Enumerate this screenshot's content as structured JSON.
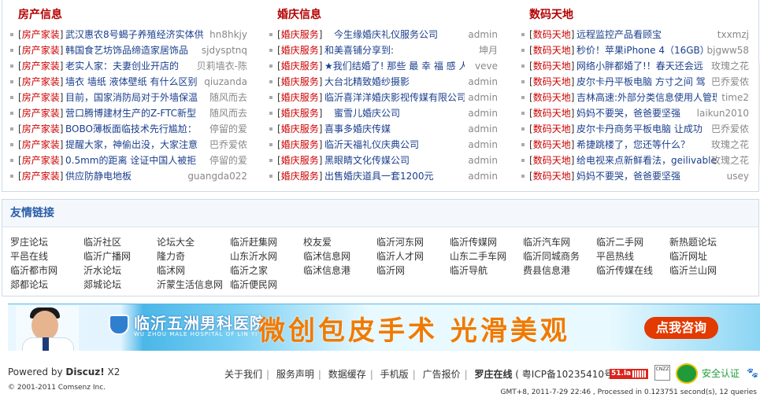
{
  "columns": [
    {
      "title": "房产信息",
      "rows": [
        {
          "cat": "房产家装",
          "title": "武汉惠农8号蝎子养殖经济实体供",
          "author": "hn8hkjy"
        },
        {
          "cat": "房产家装",
          "title": "韩国食艺坊饰品缔造家居饰品",
          "author": "sjdysptnq"
        },
        {
          "cat": "房产家装",
          "title": "老实人家：夫妻创业开店的",
          "author": "贝莉墙衣-陈"
        },
        {
          "cat": "房产家装",
          "title": "墙衣 墙纸 液体壁纸 有什么区别",
          "author": "qiuzanda"
        },
        {
          "cat": "房产家装",
          "title": "目前，国家消防局对于外墙保温",
          "author": "随风而去"
        },
        {
          "cat": "房产家装",
          "title": "营口腾博建材生产的Z-FTC新型",
          "author": "随风而去"
        },
        {
          "cat": "房产家装",
          "title": "BOBO薄板面临技术先行尴尬：",
          "author": "停留的爱"
        },
        {
          "cat": "房产家装",
          "title": "提醒大家，神偷出没，大家注意",
          "author": "巴乔爱侬"
        },
        {
          "cat": "房产家装",
          "title": "0.5mm的距离 诠证中国人被拒",
          "author": "停留的爱"
        },
        {
          "cat": "房产家装",
          "title": "供应防静电地板",
          "author": "guangda022"
        }
      ]
    },
    {
      "title": "婚庆信息",
      "rows": [
        {
          "cat": "婚庆服务",
          "title": "　今生缘婚庆礼仪服务公司",
          "author": "admin"
        },
        {
          "cat": "婚庆服务",
          "title": "和美喜铺分享到:",
          "author": "坤月"
        },
        {
          "cat": "婚庆服务",
          "title": "★我们结婚了! 那些 最 幸 福 感 人",
          "author": "veve"
        },
        {
          "cat": "婚庆服务",
          "title": "大台北精致婚纱摄影",
          "author": "admin"
        },
        {
          "cat": "婚庆服务",
          "title": "临沂喜洋洋婚庆影视传媒有限公司",
          "author": "admin"
        },
        {
          "cat": "婚庆服务",
          "title": "　蜜雪儿婚庆公司",
          "author": "admin"
        },
        {
          "cat": "婚庆服务",
          "title": "喜事多婚庆传媒",
          "author": "admin"
        },
        {
          "cat": "婚庆服务",
          "title": "临沂天福礼仪庆典公司",
          "author": "admin"
        },
        {
          "cat": "婚庆服务",
          "title": "黑眼睛文化传媒公司",
          "author": "admin"
        },
        {
          "cat": "婚庆服务",
          "title": "出售婚庆道具一套1200元",
          "author": "admin"
        }
      ]
    },
    {
      "title": "数码天地",
      "rows": [
        {
          "cat": "数码天地",
          "title": "远程监控产品看顾宝",
          "author": "txxmzj"
        },
        {
          "cat": "数码天地",
          "title": "秒价！苹果iPhone 4（16GB）",
          "author": "bjgww58"
        },
        {
          "cat": "数码天地",
          "title": "网络小胖都婚了!！春天还会远",
          "author": "玫瑰之花"
        },
        {
          "cat": "数码天地",
          "title": "皮尔卡丹平板电脑 方寸之间 驾",
          "author": "巴乔爱侬"
        },
        {
          "cat": "数码天地",
          "title": "吉林高速:外部分类信息使用人管理",
          "author": "time2"
        },
        {
          "cat": "数码天地",
          "title": "妈妈不要哭，爸爸要坚强",
          "author": "laikun2010"
        },
        {
          "cat": "数码天地",
          "title": "皮尔卡丹商务平板电脑 让成功",
          "author": "巴乔爱侬"
        },
        {
          "cat": "数码天地",
          "title": "希捷跳楼了，您还等什么？",
          "author": "玫瑰之花"
        },
        {
          "cat": "数码天地",
          "title": "给电视来点新鲜看法，geilivable",
          "author": "玫瑰之花"
        },
        {
          "cat": "数码天地",
          "title": "妈妈不要哭，爸爸要坚强",
          "author": "usey"
        }
      ]
    }
  ],
  "friend_links": {
    "title": "友情链接",
    "items": [
      "罗庄论坛",
      "临沂社区",
      "论坛大全",
      "临沂赶集网",
      "校友爱",
      "临沂河东网",
      "临沂传媒网",
      "临沂汽车网",
      "临沂二手网",
      "新热题论坛",
      "平邑在线",
      "临沂广播网",
      "隆力奇",
      "山东沂水网",
      "临沭信息网",
      "临沂人才网",
      "山东二手车网",
      "临沂同城商务",
      "平邑热线",
      "临沂网址",
      "临沂都市网",
      "沂水论坛",
      "临沭网",
      "临沂之家",
      "临沭信息港",
      "临沂网",
      "临沂导航",
      "费县信息港",
      "临沂传媒在线",
      "临沂兰山网",
      "郯都论坛",
      "郯城论坛",
      "沂蒙生活信息网",
      "临沂便民网"
    ]
  },
  "banner": {
    "hospital_name": "临沂五洲男科医院",
    "hospital_en": "WU ZHOU MALE HOSPITAL OF LIN YI",
    "slogan": "微创包皮手术  光滑美观",
    "button": "点我咨询"
  },
  "footer": {
    "powered_prefix": "Powered by ",
    "powered_brand": "Discuz!",
    "powered_version": " X2",
    "copyright": "© 2001-2011 Comsenz Inc.",
    "nav": [
      "关于我们",
      "服务声明",
      "数据缓存",
      "手机版",
      "广告报价"
    ],
    "site_name": "罗庄在线",
    "icp": "( 粤ICP备10235410号 )",
    "badge51": "51.la",
    "cnzz": "CNZZ",
    "safe_label": "安全认证",
    "status": "GMT+8, 2011-7-29 22:46 , Processed in 0.123751 second(s), 12 queries"
  }
}
